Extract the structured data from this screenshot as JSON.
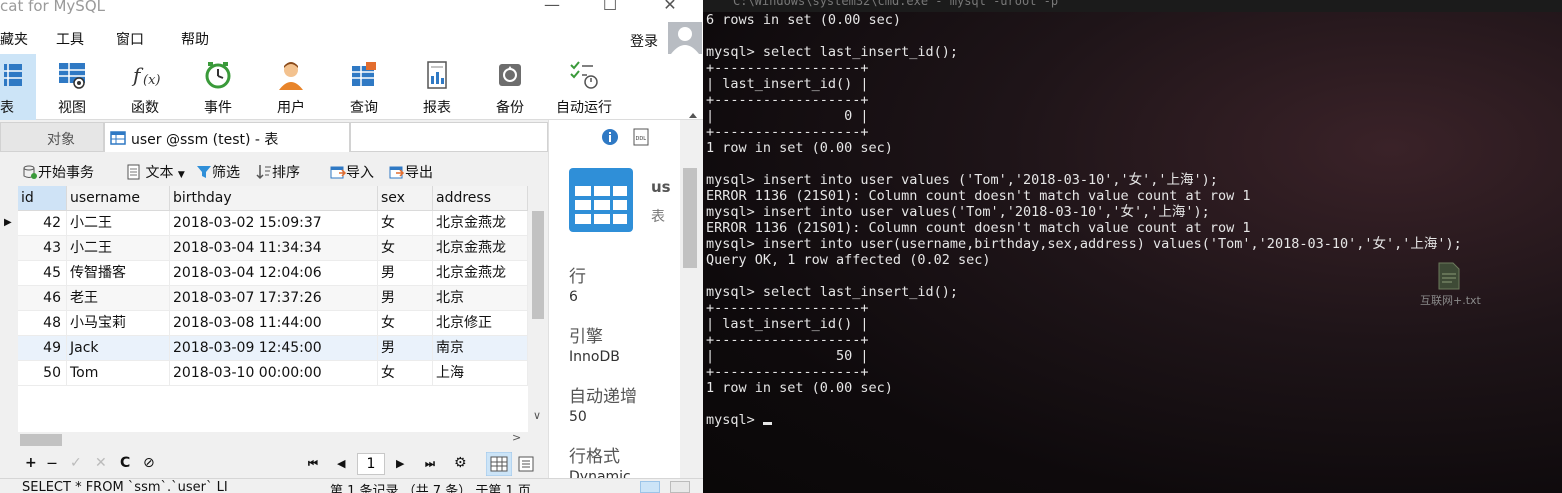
{
  "navicat": {
    "app_title": "cat for MySQL",
    "window_controls": {
      "minimize": "—",
      "maximize": "☐",
      "close": "✕"
    },
    "menu": [
      "藏夹",
      "工具",
      "窗口",
      "帮助"
    ],
    "login": "登录",
    "toolbar": [
      {
        "label": "表",
        "icon": "table-icon"
      },
      {
        "label": "视图",
        "icon": "view-icon"
      },
      {
        "label": "函数",
        "icon": "function-icon"
      },
      {
        "label": "事件",
        "icon": "event-clock-icon"
      },
      {
        "label": "用户",
        "icon": "user-icon"
      },
      {
        "label": "查询",
        "icon": "query-icon"
      },
      {
        "label": "报表",
        "icon": "report-icon"
      },
      {
        "label": "备份",
        "icon": "backup-icon"
      },
      {
        "label": "自动运行",
        "icon": "automation-icon"
      }
    ],
    "tabs": {
      "objects": "对象",
      "user_table": "user @ssm (test) - 表"
    },
    "subtoolbar": {
      "begin_transaction": "开始事务",
      "text": "文本",
      "filter": "筛选",
      "sort": "排序",
      "import": "导入",
      "export": "导出"
    },
    "grid": {
      "columns": [
        "id",
        "username",
        "birthday",
        "sex",
        "address"
      ],
      "rows": [
        [
          "42",
          "小二王",
          "2018-03-02 15:09:37",
          "女",
          "北京金燕龙"
        ],
        [
          "43",
          "小二王",
          "2018-03-04 11:34:34",
          "女",
          "北京金燕龙"
        ],
        [
          "45",
          "传智播客",
          "2018-03-04 12:04:06",
          "男",
          "北京金燕龙"
        ],
        [
          "46",
          "老王",
          "2018-03-07 17:37:26",
          "男",
          "北京"
        ],
        [
          "48",
          "小马宝莉",
          "2018-03-08 11:44:00",
          "女",
          "北京修正"
        ],
        [
          "49",
          "Jack",
          "2018-03-09 12:45:00",
          "男",
          "南京"
        ],
        [
          "50",
          "Tom",
          "2018-03-10 00:00:00",
          "女",
          "上海"
        ]
      ]
    },
    "bottombar": {
      "add": "+",
      "remove": "—",
      "apply": "✓",
      "discard": "✕",
      "refresh": "C",
      "stop": "⊘",
      "first": "⏮",
      "prev": "◀",
      "page": "1",
      "next": "▶",
      "last": "⏭",
      "settings": "⚙"
    },
    "status": {
      "sql": "SELECT * FROM `ssm`.`user` LI",
      "records": "第 1 条记录 （共 7 条） 于第 1 页"
    },
    "info": {
      "name": "us",
      "type": "表",
      "fields": [
        {
          "key": "行",
          "value": "6"
        },
        {
          "key": "引擎",
          "value": "InnoDB"
        },
        {
          "key": "自动递增",
          "value": "50"
        },
        {
          "key": "行格式",
          "value": "Dynamic"
        }
      ]
    }
  },
  "console": {
    "title": "C:\\Windows\\system32\\cmd.exe - mysql -uroot -p",
    "lines": [
      "6 rows in set (0.00 sec)",
      "",
      "mysql> select last_insert_id();",
      "+------------------+",
      "| last_insert_id() |",
      "+------------------+",
      "|                0 |",
      "+------------------+",
      "1 row in set (0.00 sec)",
      "",
      "mysql> insert into user values ('Tom','2018-03-10','女','上海');",
      "ERROR 1136 (21S01): Column count doesn't match value count at row 1",
      "mysql> insert into user values('Tom','2018-03-10','女','上海');",
      "ERROR 1136 (21S01): Column count doesn't match value count at row 1",
      "mysql> insert into user(username,birthday,sex,address) values('Tom','2018-03-10','女','上海');",
      "Query OK, 1 row affected (0.02 sec)",
      "",
      "mysql> select last_insert_id();",
      "+------------------+",
      "| last_insert_id() |",
      "+------------------+",
      "|               50 |",
      "+------------------+",
      "1 row in set (0.00 sec)",
      "",
      "mysql> "
    ],
    "desktop_file": "互联网+.txt"
  }
}
